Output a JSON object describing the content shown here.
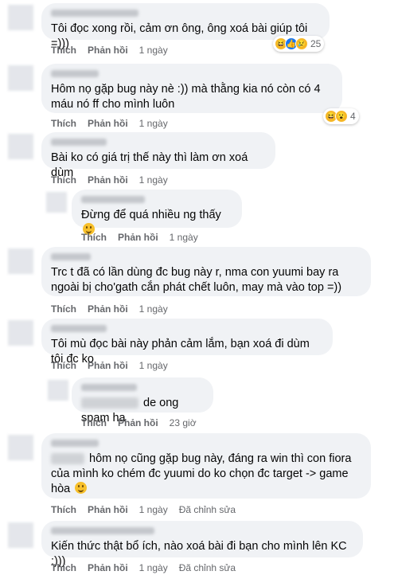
{
  "labels": {
    "like": "Thích",
    "reply": "Phản hồi",
    "edited": "Đã chỉnh sửa"
  },
  "comments": [
    {
      "text": "Tôi đọc xong rồi, cảm ơn ông, ông xoá bài giúp tôi =)))",
      "time": "1 ngày",
      "reactions": {
        "count": "25",
        "icons": [
          "haha-icon",
          "like-icon",
          "sad-icon"
        ]
      }
    },
    {
      "text": "Hôm nọ gặp bug này nè :)) mà thằng kia nó còn có 4 máu nó ff cho mình luôn",
      "time": "1 ngày",
      "reactions": {
        "count": "4",
        "icons": [
          "haha-icon",
          "wow-icon"
        ]
      }
    },
    {
      "text": "Bài ko có giá trị thế này thì làm ơn xoá dùm",
      "time": "1 ngày"
    },
    {
      "text": "Đừng để quá nhiều ng thấy",
      "time": "1 ngày"
    },
    {
      "text": "Trc t đã có lần dùng đc bug này r, nma con yuumi bay ra ngoài bị cho'gath cắn phát chết luôn, may mà vào top =))",
      "time": "1 ngày"
    },
    {
      "text": "Tôi mù đọc bài này phản cảm lắm, bạn xoá đi dùm tôi đc ko",
      "time": "1 ngày"
    },
    {
      "text": "de ong spam ha",
      "time": "23 giờ"
    },
    {
      "text": "hôm nọ cũng gặp bug này, đáng ra win thì con fiora của mình ko chém đc yuumi do ko chọn đc target -> game hòa",
      "time": "1 ngày"
    },
    {
      "text": "Kiến thức thật bổ ích, nào xoá bài đi bạn cho mình lên KC :)))",
      "time": "1 ngày"
    }
  ]
}
